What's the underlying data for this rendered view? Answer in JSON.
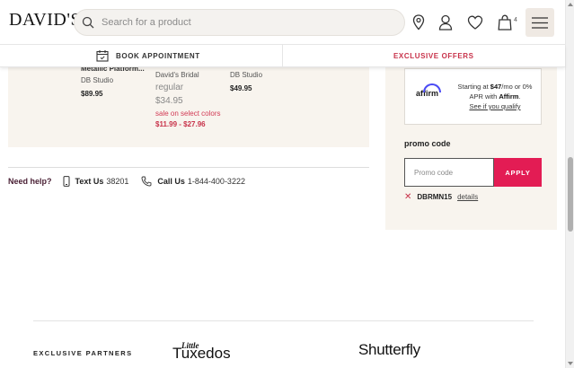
{
  "header": {
    "logo": "DAVID'S",
    "search_placeholder": "Search for a product",
    "bag_count": "4",
    "icons": [
      "search-icon",
      "location-pin-icon",
      "user-icon",
      "heart-icon",
      "bag-icon",
      "hamburger-menu-icon"
    ]
  },
  "promo_bar": {
    "book_label": "BOOK APPOINTMENT",
    "offers_label": "EXCLUSIVE OFFERS",
    "offers_color": "#c8324a"
  },
  "products": [
    {
      "name": "Metallic Platform...",
      "brand": "DB Studio",
      "price": "$89.95"
    },
    {
      "brand": "David's Bridal",
      "regular_label": "regular",
      "regular_price": "$34.95",
      "sale_label": "sale on select colors",
      "sale_price": "$11.99 - $27.96"
    },
    {
      "brand": "DB Studio",
      "price": "$49.95"
    }
  ],
  "help": {
    "need_help": "Need help?",
    "text_label": "Text Us",
    "text_number": "38201",
    "call_label": "Call Us",
    "call_number": "1-844-400-3222"
  },
  "affirm": {
    "logo": "affirm",
    "line1_pre": "Starting at ",
    "amount": "$47",
    "line1_post": "/mo or 0% APR with ",
    "brand": "Affirm",
    "period": ".",
    "link": "See if you qualify",
    "accent": "#4a4af4"
  },
  "promo": {
    "title": "promo code",
    "placeholder": "Promo code",
    "apply_label": "APPLY",
    "apply_color": "#e31c54",
    "applied_code": "DBRMN15",
    "details_label": "details"
  },
  "footer": {
    "partners_label": "EXCLUSIVE PARTNERS",
    "partner_logos": [
      "Little Tuxedos",
      "Shutterfly"
    ]
  }
}
